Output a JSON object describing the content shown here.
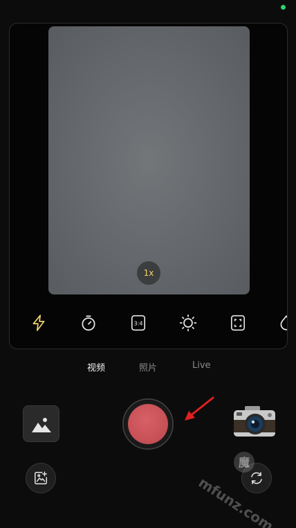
{
  "viewfinder": {
    "zoom_label": "1x"
  },
  "toolbar": {
    "icons": [
      "flash-icon",
      "timer-icon",
      "aspect-ratio-icon",
      "brightness-icon",
      "frame-icon",
      "filter-icon"
    ],
    "aspect_label": "3:4"
  },
  "modes": [
    {
      "label": "视频",
      "active": true
    },
    {
      "label": "照片",
      "active": false
    },
    {
      "label": "Live",
      "active": false
    }
  ],
  "watermark": {
    "text": "mfunz.com",
    "badge": "魔"
  },
  "colors": {
    "shutter": "#c44f55",
    "accent": "#f1d36a",
    "arrow": "#e02020",
    "status": "#2fd36b"
  }
}
